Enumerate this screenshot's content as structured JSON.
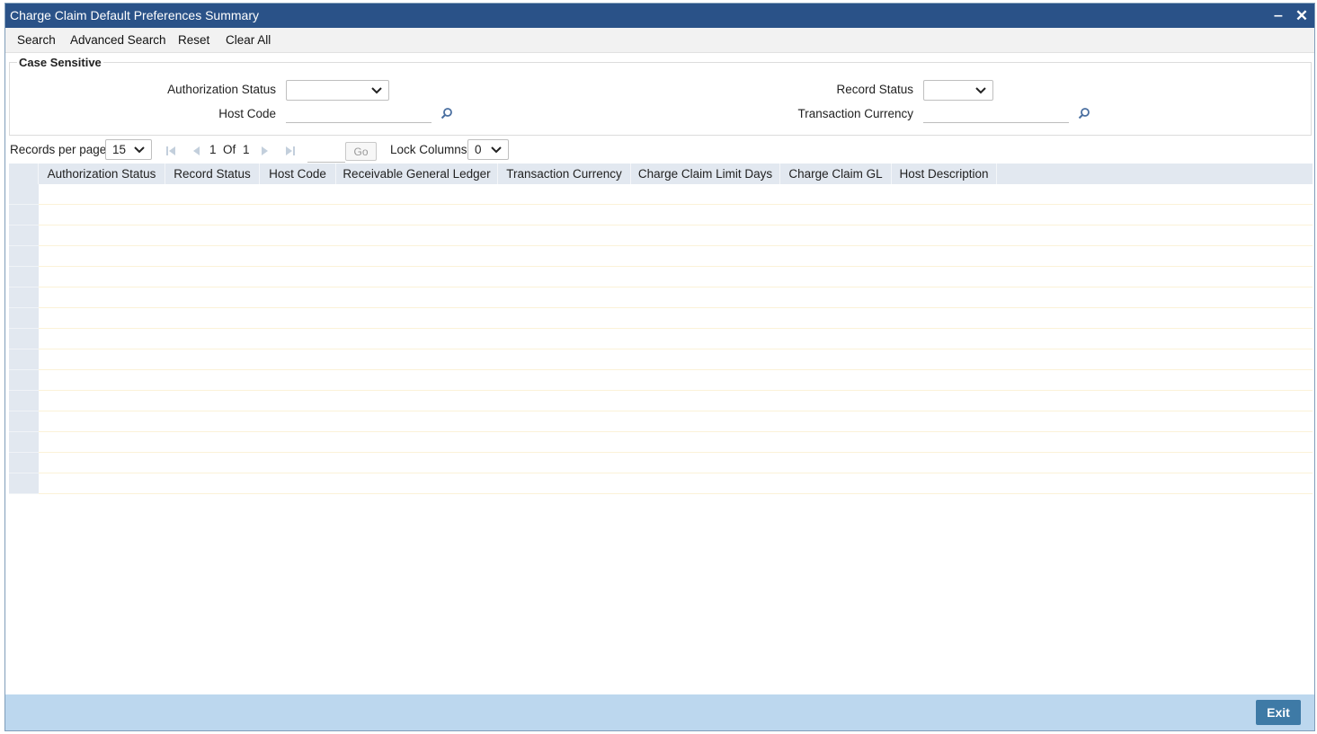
{
  "window": {
    "title": "Charge Claim Default Preferences Summary",
    "minimize": "‒",
    "close": "✕"
  },
  "toolbar": {
    "search": "Search",
    "advanced_search": "Advanced Search",
    "reset": "Reset",
    "clear_all": "Clear All"
  },
  "criteria": {
    "legend": "Case Sensitive",
    "authorization_status": {
      "label": "Authorization Status",
      "value": ""
    },
    "record_status": {
      "label": "Record Status",
      "value": ""
    },
    "host_code": {
      "label": "Host Code",
      "value": ""
    },
    "transaction_currency": {
      "label": "Transaction Currency",
      "value": ""
    }
  },
  "pager": {
    "records_per_page_label": "Records per page",
    "records_per_page": "15",
    "current_page": "1",
    "of_label": "Of",
    "total_pages": "1",
    "go_label": "Go",
    "lock_columns_label": "Lock Columns",
    "lock_columns": "0"
  },
  "grid": {
    "columns": [
      "Authorization Status",
      "Record Status",
      "Host Code",
      "Receivable General Ledger",
      "Transaction Currency",
      "Charge Claim Limit Days",
      "Charge Claim GL",
      "Host Description"
    ],
    "row_count": 15
  },
  "footer": {
    "exit_label": "Exit"
  },
  "colors": {
    "titlebar": "#2a5288",
    "header_bg": "#e2e8f0",
    "footer_bg": "#bcd7ee",
    "exit_button": "#3e7aa6",
    "row_line": "#fbf2d8"
  }
}
